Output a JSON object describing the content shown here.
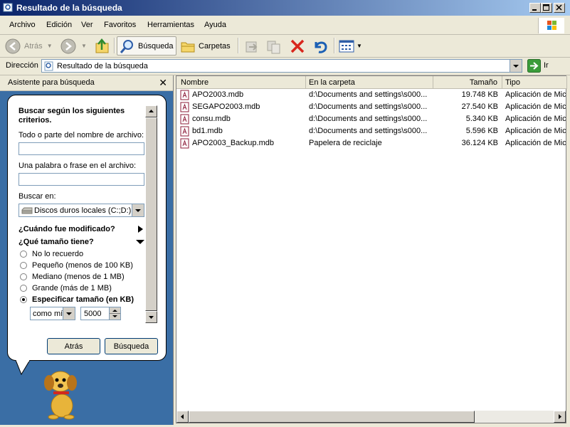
{
  "window": {
    "title": "Resultado de la búsqueda"
  },
  "menu": [
    "Archivo",
    "Edición",
    "Ver",
    "Favoritos",
    "Herramientas",
    "Ayuda"
  ],
  "toolbar": {
    "back_label": "Atrás",
    "search_label": "Búsqueda",
    "folders_label": "Carpetas"
  },
  "address": {
    "label": "Dirección",
    "value": "Resultado de la búsqueda",
    "go_label": "Ir"
  },
  "search_pane": {
    "header": "Asistente para búsqueda",
    "close": "✕",
    "title": "Buscar según los siguientes criterios.",
    "filename_label": "Todo o parte del nombre de archivo:",
    "filename_value": "",
    "phrase_label": "Una palabra o frase en el archivo:",
    "phrase_value": "",
    "lookin_label": "Buscar en:",
    "lookin_value": "Discos duros locales (C:;D:)",
    "when_modified": "¿Cuándo fue modificado?",
    "size_question": "¿Qué tamaño tiene?",
    "size_options": [
      {
        "label": "No lo recuerdo",
        "selected": false
      },
      {
        "label": "Pequeño (menos de 100 KB)",
        "selected": false
      },
      {
        "label": "Mediano (menos de 1 MB)",
        "selected": false
      },
      {
        "label": "Grande (más de 1 MB)",
        "selected": false
      },
      {
        "label": "Especificar tamaño (en KB)",
        "selected": true
      }
    ],
    "size_mode": "como mín",
    "size_value": "5000",
    "back_button": "Atrás",
    "search_button": "Búsqueda"
  },
  "results": {
    "columns": [
      "Nombre",
      "En la carpeta",
      "Tamaño",
      "Tipo"
    ],
    "rows": [
      {
        "name": "APO2003.mdb",
        "folder": "d:\\Documents and settings\\s000...",
        "size": "19.748 KB",
        "type": "Aplicación de Micr"
      },
      {
        "name": "SEGAPO2003.mdb",
        "folder": "d:\\Documents and settings\\s000...",
        "size": "27.540 KB",
        "type": "Aplicación de Micr"
      },
      {
        "name": "consu.mdb",
        "folder": "d:\\Documents and settings\\s000...",
        "size": "5.340 KB",
        "type": "Aplicación de Micr"
      },
      {
        "name": "bd1.mdb",
        "folder": "d:\\Documents and settings\\s000...",
        "size": "5.596 KB",
        "type": "Aplicación de Micr"
      },
      {
        "name": "APO2003_Backup.mdb",
        "folder": "Papelera de reciclaje",
        "size": "36.124 KB",
        "type": "Aplicación de Micr"
      }
    ]
  },
  "colors": {
    "titlebar_start": "#0a246a",
    "pane_bg": "#3a6ea5"
  }
}
